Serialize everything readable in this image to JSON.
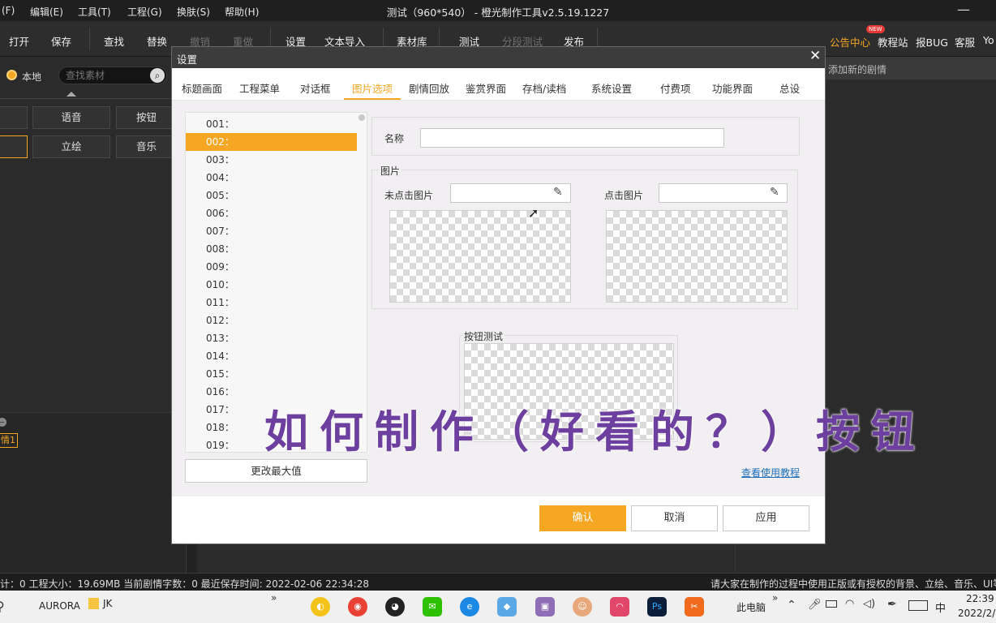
{
  "menubar": {
    "items": [
      "(F)",
      "编辑(E)",
      "工具(T)",
      "工程(G)",
      "换肤(S)",
      "帮助(H)"
    ],
    "title": "测试（960*540） - 橙光制作工具v2.5.19.1227"
  },
  "toolbar": {
    "items": [
      "打开",
      "保存",
      "查找",
      "替换",
      "撤销",
      "重做",
      "设置",
      "文本导入",
      "素材库",
      "测试",
      "分段测试",
      "发布"
    ],
    "right_links": [
      "公告中心",
      "教程站",
      "报BUG",
      "客服",
      "Yo"
    ],
    "new_badge": "NEW"
  },
  "leftpanel": {
    "local_label": "本地",
    "search_placeholder": "查找素材",
    "buttons": [
      "语音",
      "按钮",
      "立绘",
      "音乐"
    ],
    "bottom_tag": "情1"
  },
  "rightpanel": {
    "add_plot": "添加新的剧情"
  },
  "dialog": {
    "title": "设置",
    "tabs": [
      "标题画面",
      "工程菜单",
      "对话框",
      "图片选项",
      "剧情回放",
      "鉴赏界面",
      "存档/读档",
      "系统设置",
      "付费项",
      "功能界面",
      "总设"
    ],
    "active_tab": "图片选项",
    "list": [
      "001：",
      "002：",
      "003：",
      "004：",
      "005：",
      "006：",
      "007：",
      "008：",
      "009：",
      "010：",
      "011：",
      "012：",
      "013：",
      "014：",
      "015：",
      "016：",
      "017：",
      "018：",
      "019："
    ],
    "selected_index": 1,
    "change_max": "更改最大值",
    "name_label": "名称",
    "name_value": "",
    "image_group": "图片",
    "unclicked_label": "未点击图片",
    "clicked_label": "点击图片",
    "button_test": "按钮测试",
    "tutorial_link": "查看使用教程",
    "confirm": "确认",
    "cancel": "取消",
    "apply": "应用"
  },
  "overlay_title": "如何制作（好看的？）按钮",
  "statusbar": {
    "left": "计：0  工程大小：19.69MB  当前剧情字数：0    最近保存时间:   2022-02-06 22:34:28",
    "right": "请大家在制作的过程中使用正版或有授权的背景、立绘、音乐、UI等"
  },
  "taskbar": {
    "aurora": "AURORA",
    "jk": "JK",
    "this_pc": "此电脑",
    "ime": "中",
    "time": "22:39",
    "date": "2022/2/"
  },
  "colors": {
    "accent": "#f5a623",
    "overlay": "#6d3f9e",
    "link": "#1e6fb8"
  }
}
